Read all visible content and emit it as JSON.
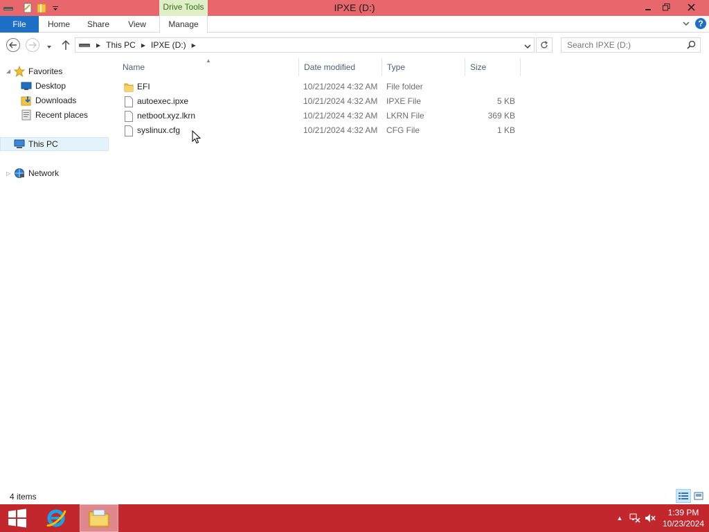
{
  "window": {
    "title": "IPXE (D:)",
    "contextual_tab_group": "Drive Tools",
    "title_bar_color": "#e8676d"
  },
  "ribbon": {
    "tabs": [
      {
        "label": "File"
      },
      {
        "label": "Home"
      },
      {
        "label": "Share"
      },
      {
        "label": "View"
      },
      {
        "label": "Manage"
      }
    ],
    "file_tab_color": "#1e6fc6"
  },
  "address_bar": {
    "segments": [
      "This PC",
      "IPXE (D:)"
    ]
  },
  "search": {
    "placeholder": "Search IPXE (D:)"
  },
  "nav_pane": {
    "favorites_label": "Favorites",
    "favorites": [
      {
        "label": "Desktop",
        "icon": "desktop-icon"
      },
      {
        "label": "Downloads",
        "icon": "downloads-icon"
      },
      {
        "label": "Recent places",
        "icon": "recent-places-icon"
      }
    ],
    "this_pc_label": "This PC",
    "network_label": "Network"
  },
  "file_list": {
    "columns": [
      "Name",
      "Date modified",
      "Type",
      "Size"
    ],
    "rows": [
      {
        "name": "EFI",
        "date": "10/21/2024 4:32 AM",
        "type": "File folder",
        "size": "",
        "icon": "folder-icon"
      },
      {
        "name": "autoexec.ipxe",
        "date": "10/21/2024 4:32 AM",
        "type": "IPXE File",
        "size": "5 KB",
        "icon": "file-icon"
      },
      {
        "name": "netboot.xyz.lkrn",
        "date": "10/21/2024 4:32 AM",
        "type": "LKRN File",
        "size": "369 KB",
        "icon": "file-icon"
      },
      {
        "name": "syslinux.cfg",
        "date": "10/21/2024 4:32 AM",
        "type": "CFG File",
        "size": "1 KB",
        "icon": "file-icon"
      }
    ]
  },
  "status_bar": {
    "item_count": "4 items"
  },
  "taskbar": {
    "color": "#c1272d",
    "time": "1:39 PM",
    "date": "10/23/2024"
  }
}
